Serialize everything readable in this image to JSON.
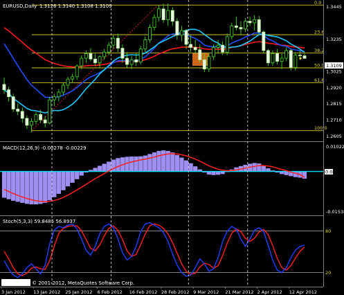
{
  "main_chart": {
    "symbol_label": "EURUSD,Daily",
    "ohlc_label": "1.3126 1.3140 1.3108 1.3109",
    "price_ticks": [
      "1.3445",
      "1.3235",
      "1.3025",
      "1.2920",
      "1.2815",
      "1.2710",
      "1.2605"
    ],
    "current_price": "1.3109",
    "fibo_levels": [
      "0.0",
      "23.6",
      "38.2",
      "50.0",
      "61.8",
      "100.0"
    ]
  },
  "macd_panel": {
    "label": "MACD(12,26,9) -0.00278 -0.00229",
    "ticks": [
      "0.01022",
      "-0.01538"
    ],
    "zero_tag": "0.00"
  },
  "stoch_panel": {
    "label": "Stoch(5,3,3) 59.8485 56.8937",
    "ticks": [
      "80",
      "20"
    ]
  },
  "copyright": "© 2001-2012, MetaQuotes Software Corp.",
  "time_axis": [
    "3 Jan 2012",
    "13 Jan 2012",
    "25 Jan 2012",
    "6 Feb 2012",
    "16 Feb 2012",
    "28 Feb 2012",
    "9 Mar 2012",
    "21 Mar 2012",
    "2 Apr 2012",
    "12 Apr 2012"
  ],
  "chart_data": [
    {
      "type": "candlestick",
      "title": "EURUSD,Daily",
      "ylim": [
        1.258,
        1.347
      ],
      "ohlc": [
        [
          1.294,
          1.2985,
          1.288,
          1.2905
        ],
        [
          1.2905,
          1.2925,
          1.283,
          1.286
        ],
        [
          1.286,
          1.288,
          1.276,
          1.278
        ],
        [
          1.278,
          1.2815,
          1.274,
          1.2765
        ],
        [
          1.2765,
          1.279,
          1.269,
          1.272
        ],
        [
          1.272,
          1.274,
          1.265,
          1.2675
        ],
        [
          1.2675,
          1.272,
          1.263,
          1.27
        ],
        [
          1.27,
          1.276,
          1.268,
          1.2745
        ],
        [
          1.2745,
          1.2775,
          1.269,
          1.271
        ],
        [
          1.271,
          1.2735,
          1.266,
          1.269
        ],
        [
          1.269,
          1.286,
          1.268,
          1.284
        ],
        [
          1.284,
          1.288,
          1.28,
          1.286
        ],
        [
          1.286,
          1.291,
          1.283,
          1.289
        ],
        [
          1.289,
          1.295,
          1.287,
          1.2935
        ],
        [
          1.2935,
          1.299,
          1.291,
          1.2975
        ],
        [
          1.2975,
          1.301,
          1.295,
          1.299
        ],
        [
          1.299,
          1.307,
          1.297,
          1.306
        ],
        [
          1.306,
          1.313,
          1.304,
          1.311
        ],
        [
          1.311,
          1.316,
          1.308,
          1.314
        ],
        [
          1.314,
          1.3175,
          1.309,
          1.3105
        ],
        [
          1.3105,
          1.314,
          1.306,
          1.308
        ],
        [
          1.308,
          1.313,
          1.305,
          1.312
        ],
        [
          1.312,
          1.317,
          1.31,
          1.315
        ],
        [
          1.315,
          1.3215,
          1.313,
          1.3195
        ],
        [
          1.3195,
          1.326,
          1.317,
          1.324
        ],
        [
          1.324,
          1.327,
          1.315,
          1.3175
        ],
        [
          1.3175,
          1.32,
          1.308,
          1.311
        ],
        [
          1.311,
          1.315,
          1.305,
          1.307
        ],
        [
          1.307,
          1.3125,
          1.304,
          1.31
        ],
        [
          1.31,
          1.3145,
          1.306,
          1.3085
        ],
        [
          1.3085,
          1.319,
          1.307,
          1.317
        ],
        [
          1.317,
          1.325,
          1.315,
          1.323
        ],
        [
          1.323,
          1.333,
          1.321,
          1.331
        ],
        [
          1.331,
          1.3395,
          1.329,
          1.3375
        ],
        [
          1.3375,
          1.3455,
          1.335,
          1.343
        ],
        [
          1.343,
          1.3465,
          1.334,
          1.336
        ],
        [
          1.336,
          1.3465,
          1.332,
          1.342
        ],
        [
          1.342,
          1.344,
          1.332,
          1.335
        ],
        [
          1.335,
          1.337,
          1.323,
          1.326
        ],
        [
          1.326,
          1.332,
          1.322,
          1.329
        ],
        [
          1.329,
          1.33,
          1.317,
          1.32
        ],
        [
          1.32,
          1.326,
          1.315,
          1.318
        ],
        [
          1.318,
          1.323,
          1.314,
          1.3165
        ],
        [
          1.3165,
          1.32,
          1.308,
          1.31
        ],
        [
          1.31,
          1.314,
          1.302,
          1.304
        ],
        [
          1.304,
          1.314,
          1.302,
          1.312
        ],
        [
          1.312,
          1.32,
          1.31,
          1.318
        ],
        [
          1.318,
          1.323,
          1.314,
          1.3195
        ],
        [
          1.3195,
          1.322,
          1.313,
          1.315
        ],
        [
          1.315,
          1.327,
          1.313,
          1.325
        ],
        [
          1.325,
          1.334,
          1.323,
          1.332
        ],
        [
          1.332,
          1.338,
          1.329,
          1.331
        ],
        [
          1.331,
          1.335,
          1.326,
          1.33
        ],
        [
          1.33,
          1.337,
          1.328,
          1.335
        ],
        [
          1.335,
          1.338,
          1.332,
          1.334
        ],
        [
          1.334,
          1.339,
          1.329,
          1.336
        ],
        [
          1.336,
          1.3385,
          1.326,
          1.328
        ],
        [
          1.328,
          1.329,
          1.314,
          1.316
        ],
        [
          1.316,
          1.317,
          1.306,
          1.308
        ],
        [
          1.308,
          1.316,
          1.306,
          1.314
        ],
        [
          1.314,
          1.317,
          1.307,
          1.309
        ],
        [
          1.309,
          1.314,
          1.304,
          1.311
        ],
        [
          1.311,
          1.318,
          1.309,
          1.316
        ],
        [
          1.316,
          1.317,
          1.303,
          1.305
        ],
        [
          1.305,
          1.315,
          1.303,
          1.313
        ],
        [
          1.313,
          1.316,
          1.31,
          1.3126
        ],
        [
          1.3126,
          1.314,
          1.3108,
          1.3109
        ]
      ]
    },
    {
      "type": "bar",
      "title": "MACD(12,26,9)",
      "ylim": [
        -0.0168,
        0.0112
      ],
      "values": [
        -0.0102,
        -0.0108,
        -0.0114,
        -0.0118,
        -0.0122,
        -0.0126,
        -0.0128,
        -0.0128,
        -0.0126,
        -0.0122,
        -0.0112,
        -0.01,
        -0.0087,
        -0.0073,
        -0.0058,
        -0.0044,
        -0.003,
        -0.0016,
        -0.0004,
        0.0006,
        0.0014,
        0.0022,
        0.003,
        0.0038,
        0.0046,
        0.0052,
        0.0055,
        0.0057,
        0.0058,
        0.0058,
        0.0059,
        0.0062,
        0.0068,
        0.0074,
        0.008,
        0.0082,
        0.008,
        0.0074,
        0.0064,
        0.0054,
        0.0043,
        0.0032,
        0.002,
        0.0008,
        -0.0004,
        -0.0012,
        -0.0014,
        -0.0013,
        -0.001,
        -0.0002,
        0.0008,
        0.0016,
        0.0021,
        0.0026,
        0.003,
        0.0033,
        0.0031,
        0.0022,
        0.0012,
        0.0004,
        -0.0004,
        -0.001,
        -0.0014,
        -0.0018,
        -0.0022,
        -0.0024,
        -0.0028
      ],
      "signal": [
        -0.007,
        -0.0078,
        -0.0086,
        -0.0093,
        -0.0099,
        -0.0105,
        -0.011,
        -0.0114,
        -0.0116,
        -0.0117,
        -0.0116,
        -0.0113,
        -0.0108,
        -0.0101,
        -0.0092,
        -0.0082,
        -0.0072,
        -0.0061,
        -0.005,
        -0.0039,
        -0.0028,
        -0.0018,
        -0.0008,
        0.0002,
        0.0011,
        0.0019,
        0.0026,
        0.0032,
        0.0037,
        0.0041,
        0.0045,
        0.0048,
        0.0052,
        0.0056,
        0.0061,
        0.0065,
        0.0068,
        0.0069,
        0.0068,
        0.0065,
        0.0061,
        0.0055,
        0.0048,
        0.004,
        0.0031,
        0.0022,
        0.0015,
        0.0009,
        0.0005,
        0.0003,
        0.0004,
        0.0006,
        0.0009,
        0.0013,
        0.0017,
        0.002,
        0.0023,
        0.0023,
        0.0021,
        0.0018,
        0.0013,
        0.0008,
        0.0003,
        -0.0002,
        -0.0007,
        -0.0012,
        -0.0023
      ]
    },
    {
      "type": "line",
      "title": "Stoch(5,3,3)",
      "ylim": [
        0,
        100
      ],
      "series": [
        {
          "name": "main",
          "values": [
            35,
            22,
            12,
            8,
            14,
            24,
            30,
            22,
            14,
            28,
            62,
            84,
            90,
            88,
            92,
            94,
            86,
            70,
            52,
            44,
            58,
            78,
            90,
            94,
            88,
            70,
            48,
            36,
            42,
            58,
            82,
            94,
            96,
            92,
            88,
            80,
            66,
            46,
            28,
            16,
            10,
            12,
            24,
            38,
            30,
            18,
            22,
            40,
            66,
            82,
            90,
            86,
            70,
            58,
            70,
            84,
            88,
            82,
            60,
            36,
            20,
            16,
            24,
            40,
            52,
            58,
            60
          ]
        },
        {
          "name": "signal",
          "values": [
            50,
            38,
            24,
            14,
            11,
            15,
            23,
            25,
            22,
            21,
            35,
            58,
            79,
            87,
            90,
            91,
            91,
            83,
            69,
            55,
            51,
            60,
            75,
            87,
            91,
            84,
            69,
            51,
            42,
            45,
            61,
            78,
            91,
            94,
            92,
            87,
            78,
            64,
            47,
            30,
            18,
            13,
            15,
            25,
            31,
            29,
            23,
            27,
            43,
            63,
            79,
            86,
            82,
            71,
            66,
            71,
            81,
            85,
            77,
            59,
            39,
            24,
            20,
            27,
            39,
            50,
            57
          ]
        }
      ]
    }
  ]
}
